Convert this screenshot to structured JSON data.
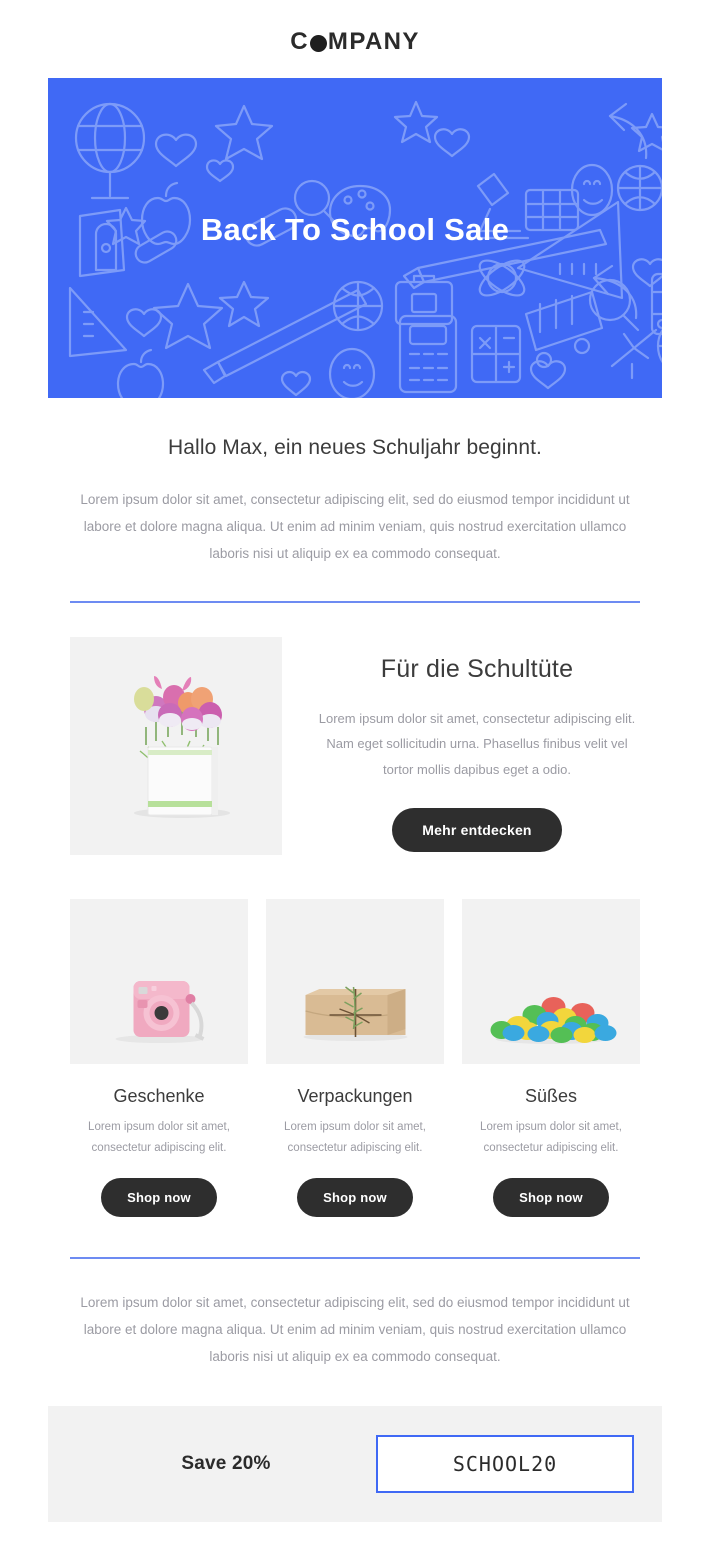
{
  "colors": {
    "brand_blue": "#4069f5",
    "divider_blue": "#6d8bf2",
    "button_dark": "#2e2e2e",
    "muted_text": "#9b9ba3",
    "heading_text": "#3c3c3c",
    "image_bg": "#f2f2f2"
  },
  "header": {
    "logo_part1": "C",
    "logo_part2": "MPANY"
  },
  "hero": {
    "title": "Back To School Sale",
    "background_color": "#4069f5",
    "doodle_icons": [
      "globe-icon",
      "heart-icon",
      "star-icon",
      "magnifier-icon",
      "palette-icon",
      "apple-icon",
      "microscope-icon",
      "dice-icon",
      "theater-masks-icon",
      "world-globe-icon",
      "triangle-ruler-icon",
      "pencil-sharpener-icon",
      "bandage-icon",
      "ruler-icon",
      "pen-icon",
      "calculator-icon",
      "school-bus-icon",
      "atom-icon",
      "briefcase-icon",
      "arrow-icon",
      "compass-icon",
      "bus-icon"
    ]
  },
  "intro": {
    "greeting": "Hallo Max, ein neues Schuljahr beginnt.",
    "body": "Lorem ipsum dolor sit amet, consectetur adipiscing elit, sed do eiusmod tempor incididunt ut labore et dolore magna aliqua. Ut enim ad minim veniam, quis nostrud exercitation ullamco laboris nisi ut aliquip ex ea commodo consequat."
  },
  "feature": {
    "image_alt": "flower-bouquet-in-white-vase",
    "title": "Für die Schultüte",
    "body": "Lorem ipsum dolor sit amet, consectetur adipiscing elit. Nam eget sollicitudin urna. Phasellus finibus velit vel tortor mollis dapibus eget a odio.",
    "cta_label": "Mehr entdecken"
  },
  "cards": [
    {
      "image_alt": "pink-instant-camera",
      "title": "Geschenke",
      "body": "Lorem ipsum dolor sit amet, consectetur adipiscing elit.",
      "cta_label": "Shop now"
    },
    {
      "image_alt": "kraft-paper-wrapped-package",
      "title": "Verpackungen",
      "body": "Lorem ipsum dolor sit amet, consectetur adipiscing elit.",
      "cta_label": "Shop now"
    },
    {
      "image_alt": "colorful-candy-pile",
      "title": "Süßes",
      "body": "Lorem ipsum dolor sit amet, consectetur adipiscing elit.",
      "cta_label": "Shop now"
    }
  ],
  "footer": {
    "body": "Lorem ipsum dolor sit amet, consectetur adipiscing elit, sed do eiusmod tempor incididunt ut labore et dolore magna aliqua. Ut enim ad minim veniam, quis nostrud exercitation ullamco laboris nisi ut aliquip ex ea commodo consequat."
  },
  "coupon": {
    "save_label": "Save 20%",
    "code": "SCHOOL20"
  }
}
